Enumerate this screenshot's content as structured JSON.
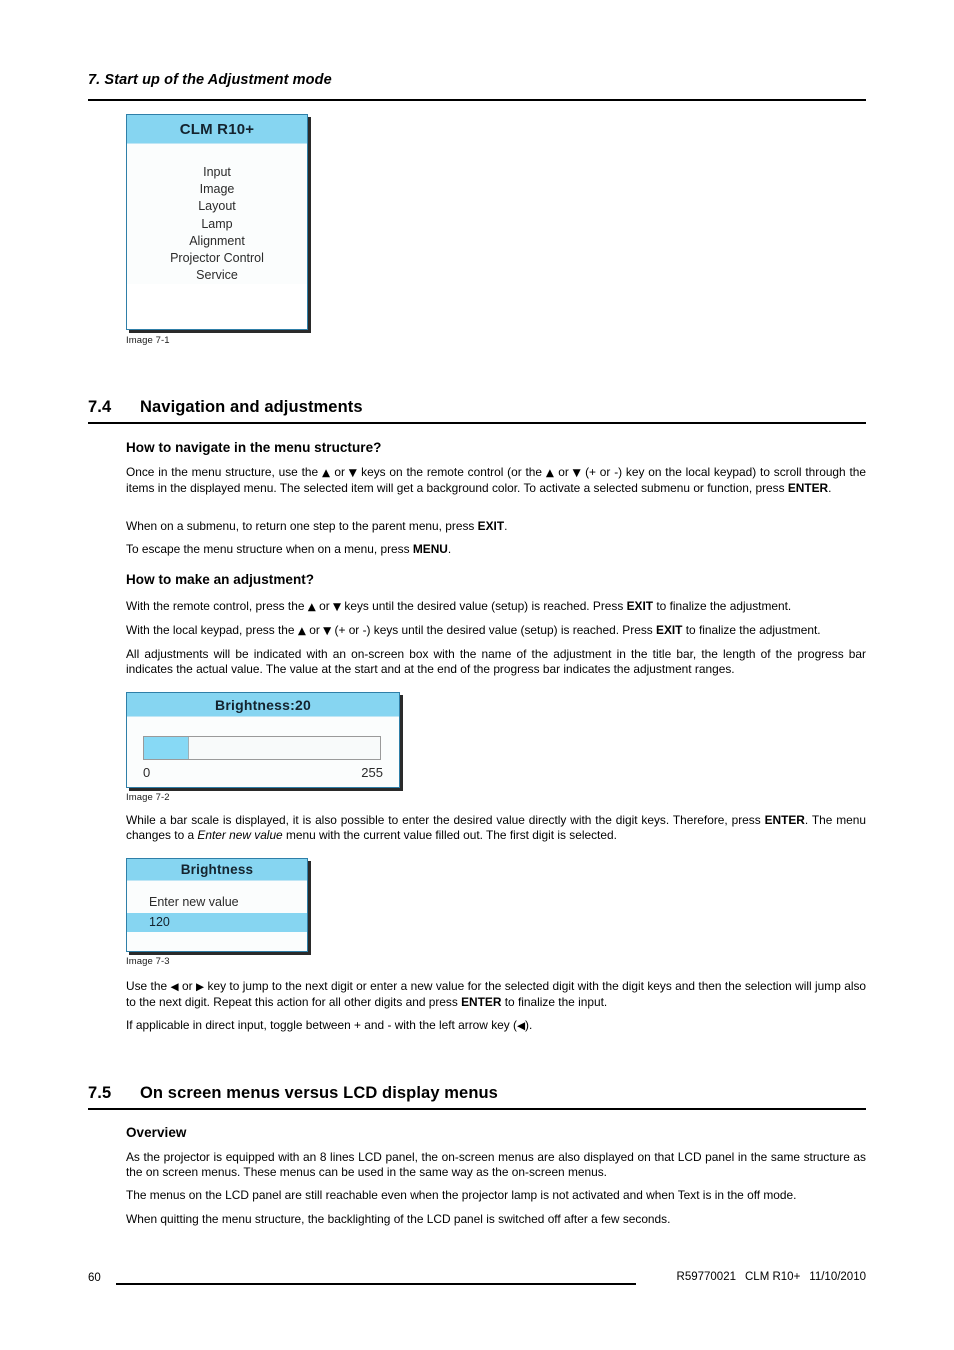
{
  "header": {
    "chapter": "7.  Start up of the Adjustment mode"
  },
  "images": {
    "img_7_1": {
      "caption": "Image 7-1",
      "title": "CLM R10+",
      "items": [
        "Input",
        "Image",
        "Layout",
        "Lamp",
        "Alignment",
        "Projector Control",
        "Service"
      ]
    },
    "img_7_2": {
      "caption": "Image 7-2",
      "title": "Brightness:20",
      "min": "0",
      "max": "255",
      "fill_percent": 19
    },
    "img_7_3": {
      "caption": "Image 7-3",
      "title": "Brightness",
      "prompt": "Enter new value",
      "value": "120"
    }
  },
  "sections": [
    {
      "number": "7.4",
      "title": "Navigation and adjustments",
      "subheads": [
        "How to navigate in the menu structure?",
        "How to make an adjustment?"
      ]
    },
    {
      "number": "7.5",
      "title": "On screen menus versus LCD display menus",
      "subheads": [
        "Overview"
      ]
    }
  ],
  "paragraphs": {
    "nav_p1_a": "Once in the menu structure, use the ",
    "nav_p1_b": " or ",
    "nav_p1_c": " keys on the remote control (or the ",
    "nav_p1_d": " or ",
    "nav_p1_e": " (+ or -) key on the local keypad) to scroll through the items in the displayed menu. The selected item will get a background color. To activate a selected submenu or function, press ",
    "nav_p1_key": "ENTER",
    "nav_p1_f": ".",
    "nav_p2_a": "When on a submenu, to return one step to the parent menu, press ",
    "nav_p2_key": "EXIT",
    "nav_p2_b": ".",
    "nav_p3_a": "To escape the menu structure when on a menu, press ",
    "nav_p3_key": "MENU",
    "nav_p3_b": ".",
    "adj_p1_a": "With the remote control, press the ",
    "adj_p1_b": " or ",
    "adj_p1_c": " keys until the desired value (setup) is reached.  Press ",
    "adj_p1_key": "EXIT",
    "adj_p1_d": " to finalize the adjustment.",
    "adj_p2_a": "With the local keypad, press the ",
    "adj_p2_b": " or ",
    "adj_p2_c": " (+ or -) keys until the desired value (setup) is reached.  Press ",
    "adj_p2_key": "EXIT",
    "adj_p2_d": " to finalize the adjustment.",
    "adj_p3": "All adjustments will be indicated with an on-screen box with the name of the adjustment in the title bar, the length of the progress bar indicates the actual value.  The value at the start and at the end of the progress bar indicates the adjustment ranges.",
    "bar_p_a": "While a bar scale is displayed, it is also possible to enter the desired value directly with the digit keys.  Therefore, press ",
    "bar_p_key": "ENTER",
    "bar_p_b": ". The menu changes to a ",
    "bar_p_italic": "Enter new value",
    "bar_p_c": " menu with the current value filled out.  The first digit is selected.",
    "digit_p_a": "Use the ",
    "digit_p_b": " or ",
    "digit_p_c": " key to jump to the next digit or enter a new value for the selected digit with the digit keys and then the selection will jump also to the next digit.  Repeat this action for all other digits and press ",
    "digit_p_key": "ENTER",
    "digit_p_d": " to finalize the input.",
    "toggle_p_a": "If applicable in direct input, toggle between + and - with the left arrow key (",
    "toggle_p_b": ").",
    "ov_p1": "As the projector is equipped with an 8 lines LCD panel, the on-screen menus are also displayed on that LCD panel in the same structure as the on screen menus.  These menus can be used in the same way as the on-screen menus.",
    "ov_p2": "The menus on the LCD panel are still reachable even when the projector lamp is not activated and when Text is in the off mode.",
    "ov_p3": "When quitting the menu structure, the backlighting of the LCD panel is switched off after a few seconds."
  },
  "glyphs": {
    "up": "▲",
    "down": "▼",
    "left": "◀",
    "right": "▶"
  },
  "footer": {
    "page_number": "60",
    "doc_ref": "R59770021",
    "product": "CLM R10+",
    "date": "11/10/2010"
  },
  "colors": {
    "osd_title_blue": "#86d5f1",
    "osd_border": "#2f7fa8",
    "bar_fill": "#87d9f5"
  }
}
